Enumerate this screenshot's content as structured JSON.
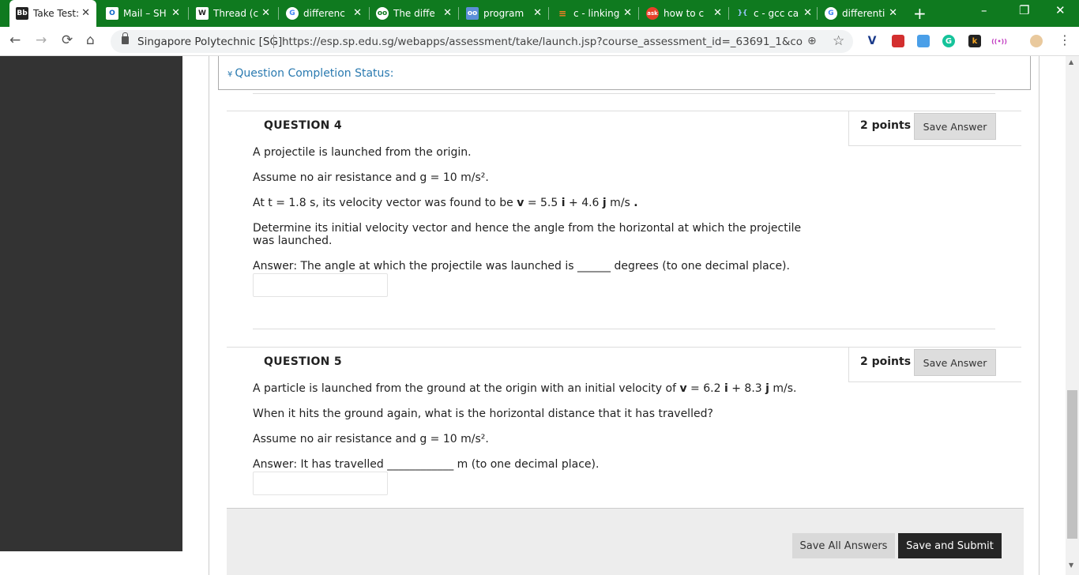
{
  "tabs": [
    {
      "label": "Take Test:",
      "icon": "blackboard-icon",
      "fav_text": "Bb",
      "fav_color": "#222222"
    },
    {
      "label": "Mail – SH",
      "icon": "outlook-icon",
      "fav_text": "O",
      "fav_color": "#0a64c8"
    },
    {
      "label": "Thread (c",
      "icon": "wikipedia-icon",
      "fav_text": "W",
      "fav_color": "#ffffff"
    },
    {
      "label": "differenc",
      "icon": "google-icon",
      "fav_text": "G",
      "fav_color": "#ffffff"
    },
    {
      "label": "The diffe",
      "icon": "owl-icon",
      "fav_text": "oo",
      "fav_color": "#ffffff"
    },
    {
      "label": "program",
      "icon": "chat-icon",
      "fav_text": "oo",
      "fav_color": "#5b8fd8"
    },
    {
      "label": "c - linking",
      "icon": "stackoverflow-icon",
      "fav_text": "≡",
      "fav_color": "#f48024"
    },
    {
      "label": "how to c",
      "icon": "ask-icon",
      "fav_text": "ask",
      "fav_color": "#e8402a"
    },
    {
      "label": "c - gcc ca",
      "icon": "stackexchange-icon",
      "fav_text": "}{",
      "fav_color": "#2b6fb5"
    },
    {
      "label": "differenti",
      "icon": "google-icon",
      "fav_text": "G",
      "fav_color": "#ffffff"
    }
  ],
  "address": {
    "site_name": "Singapore Polytechnic [SG]",
    "url": "https://esp.sp.edu.sg/webapps/assessment/take/launch.jsp?course_assessment_id=_63691_1&course_id..."
  },
  "status": {
    "label": "Question Completion Status:"
  },
  "questions": [
    {
      "title": "QUESTION 4",
      "points": "2 points",
      "save_label": "Save Answer",
      "lines": [
        "A projectile is launched from the origin.",
        "Assume no air resistance and g = 10 m/s².",
        "At t = 1.8 s, its velocity vector was found to be v = 5.5 i + 4.6 j m/s .",
        "Determine its initial velocity vector and hence the angle from the horizontal at which the projectile was launched.",
        "Answer: The angle at which the projectile was launched is ______ degrees (to one decimal place)."
      ],
      "answer_value": ""
    },
    {
      "title": "QUESTION 5",
      "points": "2 points",
      "save_label": "Save Answer",
      "lines": [
        "A particle is launched from the ground at the origin with an initial velocity of v = 6.2 i + 8.3 j m/s.",
        "When it hits the ground again, what is the horizontal distance that it has travelled?",
        "Assume no air resistance and g = 10 m/s².",
        "Answer: It has travelled ____________ m (to one decimal place)."
      ],
      "answer_value": ""
    }
  ],
  "footer": {
    "save_all": "Save All Answers",
    "save_submit": "Save and Submit"
  }
}
